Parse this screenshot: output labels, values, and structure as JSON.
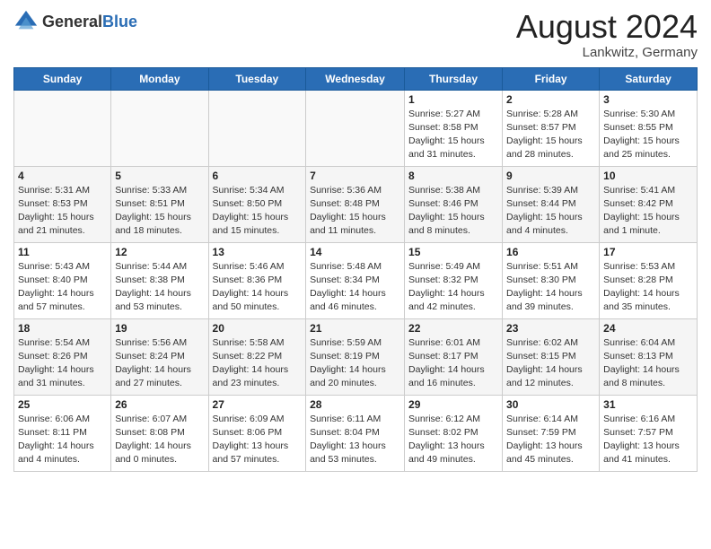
{
  "header": {
    "logo_general": "General",
    "logo_blue": "Blue",
    "month_year": "August 2024",
    "location": "Lankwitz, Germany"
  },
  "days_of_week": [
    "Sunday",
    "Monday",
    "Tuesday",
    "Wednesday",
    "Thursday",
    "Friday",
    "Saturday"
  ],
  "weeks": [
    [
      {
        "day": "",
        "info": ""
      },
      {
        "day": "",
        "info": ""
      },
      {
        "day": "",
        "info": ""
      },
      {
        "day": "",
        "info": ""
      },
      {
        "day": "1",
        "info": "Sunrise: 5:27 AM\nSunset: 8:58 PM\nDaylight: 15 hours\nand 31 minutes."
      },
      {
        "day": "2",
        "info": "Sunrise: 5:28 AM\nSunset: 8:57 PM\nDaylight: 15 hours\nand 28 minutes."
      },
      {
        "day": "3",
        "info": "Sunrise: 5:30 AM\nSunset: 8:55 PM\nDaylight: 15 hours\nand 25 minutes."
      }
    ],
    [
      {
        "day": "4",
        "info": "Sunrise: 5:31 AM\nSunset: 8:53 PM\nDaylight: 15 hours\nand 21 minutes."
      },
      {
        "day": "5",
        "info": "Sunrise: 5:33 AM\nSunset: 8:51 PM\nDaylight: 15 hours\nand 18 minutes."
      },
      {
        "day": "6",
        "info": "Sunrise: 5:34 AM\nSunset: 8:50 PM\nDaylight: 15 hours\nand 15 minutes."
      },
      {
        "day": "7",
        "info": "Sunrise: 5:36 AM\nSunset: 8:48 PM\nDaylight: 15 hours\nand 11 minutes."
      },
      {
        "day": "8",
        "info": "Sunrise: 5:38 AM\nSunset: 8:46 PM\nDaylight: 15 hours\nand 8 minutes."
      },
      {
        "day": "9",
        "info": "Sunrise: 5:39 AM\nSunset: 8:44 PM\nDaylight: 15 hours\nand 4 minutes."
      },
      {
        "day": "10",
        "info": "Sunrise: 5:41 AM\nSunset: 8:42 PM\nDaylight: 15 hours\nand 1 minute."
      }
    ],
    [
      {
        "day": "11",
        "info": "Sunrise: 5:43 AM\nSunset: 8:40 PM\nDaylight: 14 hours\nand 57 minutes."
      },
      {
        "day": "12",
        "info": "Sunrise: 5:44 AM\nSunset: 8:38 PM\nDaylight: 14 hours\nand 53 minutes."
      },
      {
        "day": "13",
        "info": "Sunrise: 5:46 AM\nSunset: 8:36 PM\nDaylight: 14 hours\nand 50 minutes."
      },
      {
        "day": "14",
        "info": "Sunrise: 5:48 AM\nSunset: 8:34 PM\nDaylight: 14 hours\nand 46 minutes."
      },
      {
        "day": "15",
        "info": "Sunrise: 5:49 AM\nSunset: 8:32 PM\nDaylight: 14 hours\nand 42 minutes."
      },
      {
        "day": "16",
        "info": "Sunrise: 5:51 AM\nSunset: 8:30 PM\nDaylight: 14 hours\nand 39 minutes."
      },
      {
        "day": "17",
        "info": "Sunrise: 5:53 AM\nSunset: 8:28 PM\nDaylight: 14 hours\nand 35 minutes."
      }
    ],
    [
      {
        "day": "18",
        "info": "Sunrise: 5:54 AM\nSunset: 8:26 PM\nDaylight: 14 hours\nand 31 minutes."
      },
      {
        "day": "19",
        "info": "Sunrise: 5:56 AM\nSunset: 8:24 PM\nDaylight: 14 hours\nand 27 minutes."
      },
      {
        "day": "20",
        "info": "Sunrise: 5:58 AM\nSunset: 8:22 PM\nDaylight: 14 hours\nand 23 minutes."
      },
      {
        "day": "21",
        "info": "Sunrise: 5:59 AM\nSunset: 8:19 PM\nDaylight: 14 hours\nand 20 minutes."
      },
      {
        "day": "22",
        "info": "Sunrise: 6:01 AM\nSunset: 8:17 PM\nDaylight: 14 hours\nand 16 minutes."
      },
      {
        "day": "23",
        "info": "Sunrise: 6:02 AM\nSunset: 8:15 PM\nDaylight: 14 hours\nand 12 minutes."
      },
      {
        "day": "24",
        "info": "Sunrise: 6:04 AM\nSunset: 8:13 PM\nDaylight: 14 hours\nand 8 minutes."
      }
    ],
    [
      {
        "day": "25",
        "info": "Sunrise: 6:06 AM\nSunset: 8:11 PM\nDaylight: 14 hours\nand 4 minutes."
      },
      {
        "day": "26",
        "info": "Sunrise: 6:07 AM\nSunset: 8:08 PM\nDaylight: 14 hours\nand 0 minutes."
      },
      {
        "day": "27",
        "info": "Sunrise: 6:09 AM\nSunset: 8:06 PM\nDaylight: 13 hours\nand 57 minutes."
      },
      {
        "day": "28",
        "info": "Sunrise: 6:11 AM\nSunset: 8:04 PM\nDaylight: 13 hours\nand 53 minutes."
      },
      {
        "day": "29",
        "info": "Sunrise: 6:12 AM\nSunset: 8:02 PM\nDaylight: 13 hours\nand 49 minutes."
      },
      {
        "day": "30",
        "info": "Sunrise: 6:14 AM\nSunset: 7:59 PM\nDaylight: 13 hours\nand 45 minutes."
      },
      {
        "day": "31",
        "info": "Sunrise: 6:16 AM\nSunset: 7:57 PM\nDaylight: 13 hours\nand 41 minutes."
      }
    ]
  ]
}
